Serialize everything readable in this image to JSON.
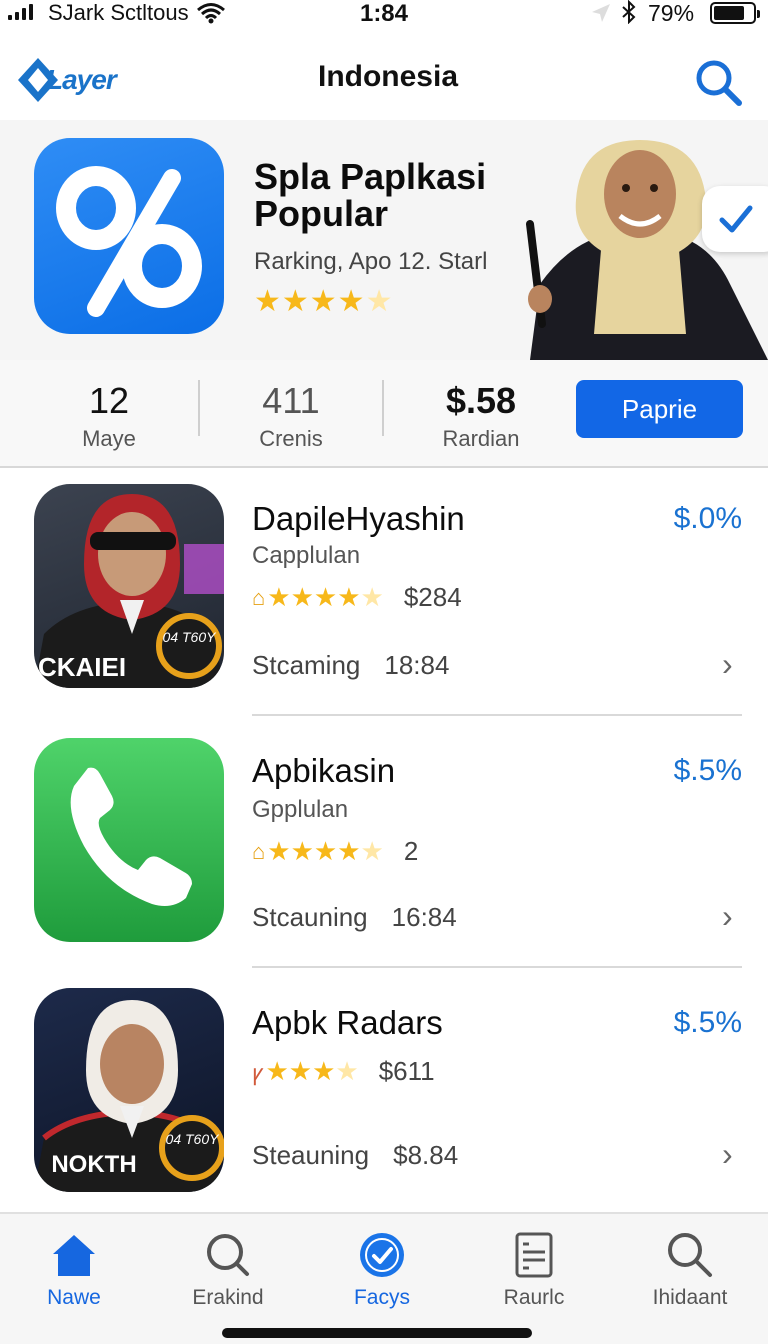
{
  "status_bar": {
    "carrier": "SJark Sctltous",
    "time": "1:84",
    "battery_percent": "79%",
    "battery_level": 0.79
  },
  "header": {
    "logo_text": "Layer",
    "title": "Indonesia"
  },
  "hero": {
    "title": "Spla Paplkasi Popular",
    "subtitle": "Rarking, Apo 12. Starl",
    "rating": 4
  },
  "stats": [
    {
      "value": "12",
      "label": "Maye"
    },
    {
      "value": "411",
      "label": "Crenis"
    },
    {
      "value": "$.58",
      "label": "Rardian"
    }
  ],
  "primary_button": "Paprie",
  "apps": [
    {
      "name": "DapileHyashin",
      "category": "Capplulan",
      "rating_value": "$284",
      "status": "Stcaming",
      "time": "18:84",
      "price": "$.0%",
      "icon_text": "CKAIEI",
      "badge_text": "04 T60Y",
      "accent": "#b3252a"
    },
    {
      "name": "Apbikasin",
      "category": "Gpplulan",
      "rating_value": "2",
      "status": "Stcauning",
      "time": "16:84",
      "price": "$.5%",
      "accent": "#2fb84c"
    },
    {
      "name": "Apbk Radars",
      "category": "",
      "rating_value": "$611",
      "status": "Steauning",
      "time": "$8.84",
      "price": "$.5%",
      "icon_text": "NOKTH",
      "badge_text": "04 T60Y",
      "accent": "#c0282d"
    }
  ],
  "tabs": [
    {
      "label": "Nawe",
      "icon": "home-icon",
      "active": true
    },
    {
      "label": "Erakind",
      "icon": "search-circle-icon",
      "active": false
    },
    {
      "label": "Facys",
      "icon": "check-badge-icon",
      "active": false
    },
    {
      "label": "Raurlc",
      "icon": "document-icon",
      "active": false
    },
    {
      "label": "Ihidaant",
      "icon": "search-icon",
      "active": false
    }
  ],
  "colors": {
    "accent_blue": "#1267e6",
    "price_blue": "#1a72d1",
    "star_gold": "#f7b81a"
  }
}
